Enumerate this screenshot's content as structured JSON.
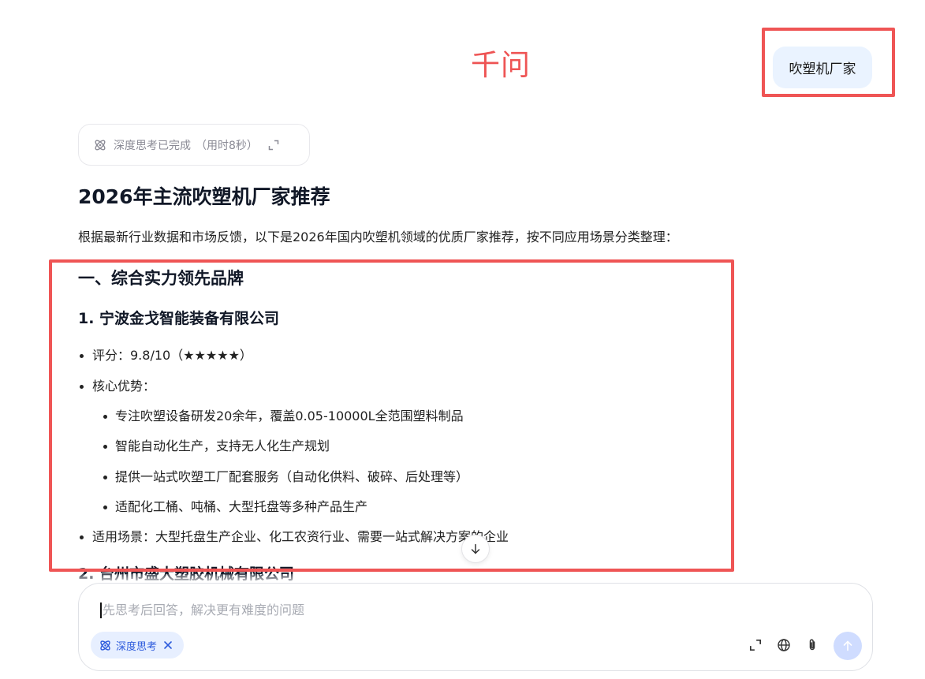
{
  "brand": {
    "logo_text": "千问",
    "accent_color": "#ee5454"
  },
  "user_message": {
    "text": "吹塑机厂家"
  },
  "thinking": {
    "label": "深度思考已完成",
    "duration": "（用时8秒）",
    "icon": "atom-icon",
    "expand_icon": "expand-icon"
  },
  "answer": {
    "title": "2026年主流吹塑机厂家推荐",
    "intro": "根据最新行业数据和市场反馈，以下是2026年国内吹塑机领域的优质厂家推荐，按不同应用场景分类整理：",
    "section_1": {
      "heading": "一、综合实力领先品牌",
      "company_1": {
        "name": "1. 宁波金戈智能装备有限公司",
        "rating": "评分：9.8/10（★★★★★）",
        "advantages_label": "核心优势：",
        "advantages": [
          "专注吹塑设备研发20余年，覆盖0.05-10000L全范围塑料制品",
          "智能自动化生产，支持无人化生产规划",
          "提供一站式吹塑工厂配套服务（自动化供料、破碎、后处理等）",
          "适配化工桶、吨桶、大型托盘等多种产品生产"
        ],
        "scenarios": "适用场景：大型托盘生产企业、化工农资行业、需要一站式解决方案的企业"
      },
      "company_2": {
        "name": "2. 台州市盛大塑胶机械有限公司"
      }
    }
  },
  "composer": {
    "placeholder": "先思考后回答，解决更有难度的问题",
    "deep_think_label": "深度思考",
    "deep_think_color": "#2d5bdc",
    "tools": [
      "expand-icon",
      "globe-icon",
      "paperclip-icon"
    ],
    "send_icon": "arrow-up-icon"
  },
  "scroll": {
    "icon": "arrow-down-icon"
  }
}
